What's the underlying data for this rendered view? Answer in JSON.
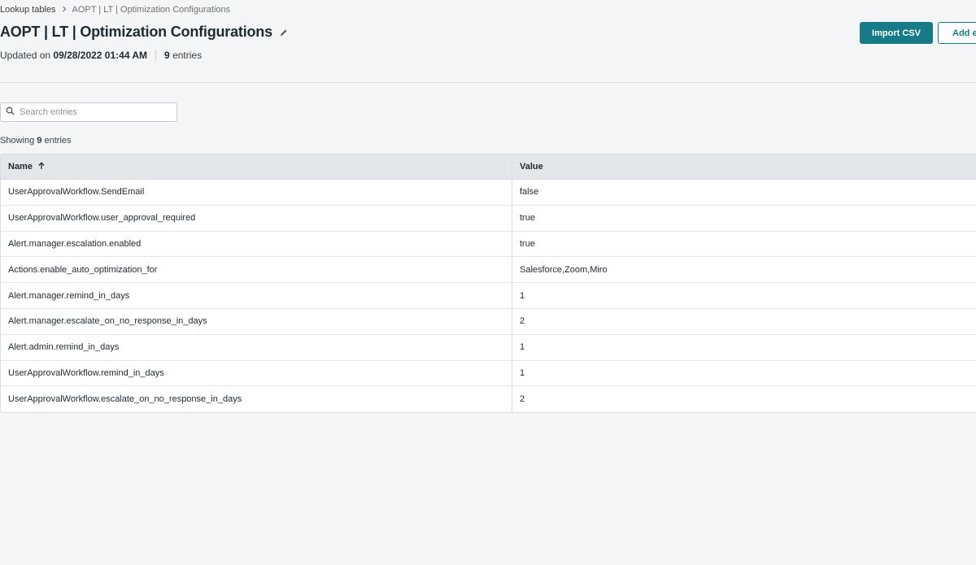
{
  "breadcrumb": {
    "parent": "Lookup tables",
    "current": "AOPT | LT | Optimization Configurations"
  },
  "header": {
    "title": "AOPT | LT | Optimization Configurations",
    "updated_prefix": "Updated on",
    "updated_at": "09/28/2022 01:44 AM",
    "entries_count": "9",
    "entries_label": "entries"
  },
  "actions": {
    "import_label": "Import CSV",
    "add_label": "Add entry"
  },
  "search": {
    "placeholder": "Search entries",
    "value": ""
  },
  "summary": {
    "prefix": "Showing",
    "count": "9",
    "suffix": "entries"
  },
  "table": {
    "columns": [
      "Name",
      "Value"
    ],
    "sort": "ascending",
    "rows": [
      {
        "name": "UserApprovalWorkflow.SendEmail",
        "value": "false"
      },
      {
        "name": "UserApprovalWorkflow.user_approval_required",
        "value": "true"
      },
      {
        "name": "Alert.manager.escalation.enabled",
        "value": "true"
      },
      {
        "name": "Actions.enable_auto_optimization_for",
        "value": "Salesforce,Zoom,Miro"
      },
      {
        "name": "Alert.manager.remind_in_days",
        "value": "1"
      },
      {
        "name": "Alert.manager.escalate_on_no_response_in_days",
        "value": "2"
      },
      {
        "name": "Alert.admin.remind_in_days",
        "value": "1"
      },
      {
        "name": "UserApprovalWorkflow.remind_in_days",
        "value": "1"
      },
      {
        "name": "UserApprovalWorkflow.escalate_on_no_response_in_days",
        "value": "2"
      }
    ]
  },
  "colors": {
    "accent": "#167b87",
    "background": "#f4f5f6",
    "table_header": "#e4e7ea"
  },
  "icons": {
    "breadcrumb_separator": "chevron-right-icon",
    "edit": "pencil-icon",
    "search": "search-icon",
    "sort": "arrow-up-icon"
  }
}
